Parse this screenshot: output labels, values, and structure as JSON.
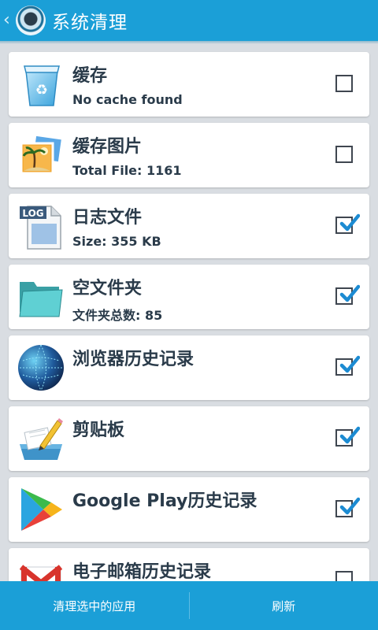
{
  "header": {
    "title": "系统清理",
    "back_icon": "chevron-left-icon",
    "app_icon": "system-cleaner-app-icon",
    "color": "#1b9fd7"
  },
  "items": [
    {
      "title": "缓存",
      "subtitle": "No cache found",
      "icon": "recycle-bin-icon",
      "checked": false
    },
    {
      "title": "缓存图片",
      "subtitle": "Total File: 1161",
      "icon": "photos-icon",
      "checked": false
    },
    {
      "title": "日志文件",
      "subtitle": "Size: 355 KB",
      "icon": "log-file-icon",
      "icon_label": "LOG",
      "checked": true
    },
    {
      "title": "空文件夹",
      "subtitle": "文件夹总数: 85",
      "icon": "folder-icon",
      "checked": true
    },
    {
      "title": "浏览器历史记录",
      "subtitle": "",
      "icon": "globe-icon",
      "checked": true
    },
    {
      "title": "剪贴板",
      "subtitle": "",
      "icon": "clipboard-pencil-icon",
      "checked": true
    },
    {
      "title": "Google Play历史记录",
      "subtitle": "",
      "icon": "google-play-icon",
      "checked": true
    },
    {
      "title": "电子邮箱历史记录",
      "subtitle": "",
      "icon": "gmail-icon",
      "checked": false
    }
  ],
  "footer": {
    "clean_label": "清理选中的应用",
    "refresh_label": "刷新"
  }
}
